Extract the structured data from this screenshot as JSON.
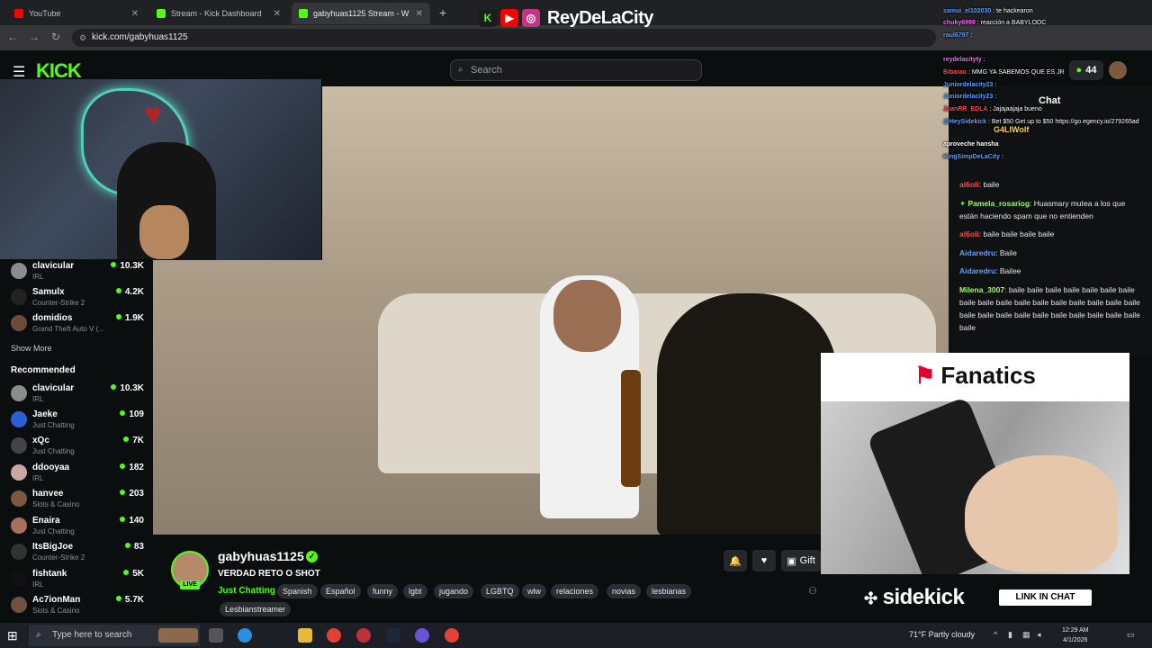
{
  "browser": {
    "tabs": [
      {
        "label": "YouTube",
        "color": "#ff0000"
      },
      {
        "label": "Stream - Kick Dashboard",
        "color": "#53fc18"
      },
      {
        "label": "gabyhuas1125 Stream - W",
        "color": "#53fc18"
      }
    ],
    "url": "kick.com/gabyhuas1125"
  },
  "overlay_brand": {
    "name": "ReyDeLaCity"
  },
  "kick": {
    "logo": "KICK",
    "search_placeholder": "Search",
    "header_count": "44"
  },
  "sidebar": {
    "following": [
      {
        "name": "clavicular",
        "category": "IRL",
        "viewers": "10.3K",
        "color": "#8c8c8c"
      },
      {
        "name": "Samulx",
        "category": "Counter-Strike 2",
        "viewers": "4.2K",
        "color": "#222"
      },
      {
        "name": "domidios",
        "category": "Grand Theft Auto V (...",
        "viewers": "1.9K",
        "color": "#6b4b3b"
      }
    ],
    "show_more": "Show More",
    "recommended_label": "Recommended",
    "recommended": [
      {
        "name": "clavicular",
        "category": "IRL",
        "viewers": "10.3K",
        "color": "#8c8c8c"
      },
      {
        "name": "Jaeke",
        "category": "Just Chatting",
        "viewers": "109",
        "color": "#2a5fd6"
      },
      {
        "name": "xQc",
        "category": "Just Chatting",
        "viewers": "7K",
        "color": "#444"
      },
      {
        "name": "ddooyaa",
        "category": "IRL",
        "viewers": "182",
        "color": "#c9a6a0"
      },
      {
        "name": "hanvee",
        "category": "Slots & Casino",
        "viewers": "203",
        "color": "#7a5a40"
      },
      {
        "name": "Enaira",
        "category": "Just Chatting",
        "viewers": "140",
        "color": "#a8705a"
      },
      {
        "name": "ItsBigJoe",
        "category": "Counter-Strike 2",
        "viewers": "83",
        "color": "#333"
      },
      {
        "name": "fishtank",
        "category": "IRL",
        "viewers": "5K",
        "color": "#111"
      },
      {
        "name": "Ac7ionMan",
        "category": "Slots & Casino",
        "viewers": "5.7K",
        "color": "#705040"
      }
    ]
  },
  "channel": {
    "name": "gabyhuas1125",
    "live_label": "LIVE",
    "title": "VERDAD RETO O SHOT",
    "category": "Just Chatting",
    "tags": [
      "Spanish",
      "Español",
      "funny",
      "lgbt",
      "jugando",
      "LGBTQ",
      "wlw",
      "relaciones",
      "novias",
      "lesbianas",
      "Lesbianstreamer"
    ],
    "gift_label": "Gift"
  },
  "chat": {
    "title": "Chat",
    "messages": [
      {
        "user": "al6oli",
        "color": "#ff4b4b",
        "text": "baile"
      },
      {
        "user": "Pamela_rosariog",
        "color": "#9dff6a",
        "text": "Huasmary mutea a los que están haciendo spam que no entienden"
      },
      {
        "user": "al6oli",
        "color": "#ff4b4b",
        "text": "baile baile baile baile"
      },
      {
        "user": "Aidaredru",
        "color": "#5aa0ff",
        "text": "Baile"
      },
      {
        "user": "Aidaredru",
        "color": "#5aa0ff",
        "text": "Bailee"
      },
      {
        "user": "Milena_3007",
        "color": "#9dff6a",
        "text": "baile baile baile baile baile baile baile baile baile baile baile baile baile baile baile baile baile baile baile baile baile baile baile baile baile baile baile baile"
      }
    ]
  },
  "overlay_chat": [
    {
      "user": "samui_el102030",
      "color": "#5aa0ff",
      "text": "te hackearon"
    },
    {
      "user": "chuky6999",
      "color": "#ff66ff",
      "text": "reacción a BABYLOOC"
    },
    {
      "user": "raul6797",
      "color": "#5aa0ff",
      "text": ""
    },
    {
      "user": "reydelacityty",
      "color": "#ff66ff",
      "text": ""
    },
    {
      "user": "Bibarao",
      "color": "#ff4b4b",
      "text": "MMG YA SABEMOS QUE ES JR"
    },
    {
      "user": "Juniordelacity23",
      "color": "#5aa0ff",
      "text": ""
    },
    {
      "user": "Juniordelacity23",
      "color": "#5aa0ff",
      "text": ""
    },
    {
      "user": "JuanRR_EDLA",
      "color": "#ff4b4b",
      "text": "Jajajaajaja bueno"
    },
    {
      "user": "@HeySidekick",
      "color": "#5aa0ff",
      "text": "Bet $50 Get up to $50 https://go.egency.io/279265ad"
    },
    {
      "user": "G4LIWolf",
      "color": "#ffd84a",
      "text": ""
    },
    {
      "user": "aproveche hansha",
      "color": "#ffffff",
      "text": ""
    },
    {
      "user": "KingSimpDeLaCity",
      "color": "#5aa0ff",
      "text": ""
    }
  ],
  "ad": {
    "brand": "Fanatics",
    "sidekick": "sidekick",
    "cta": "LINK IN CHAT"
  },
  "taskbar": {
    "search_placeholder": "Type here to search",
    "weather": "71°F  Partly cloudy",
    "time": "12:29 AM",
    "date": "4/1/2026"
  }
}
